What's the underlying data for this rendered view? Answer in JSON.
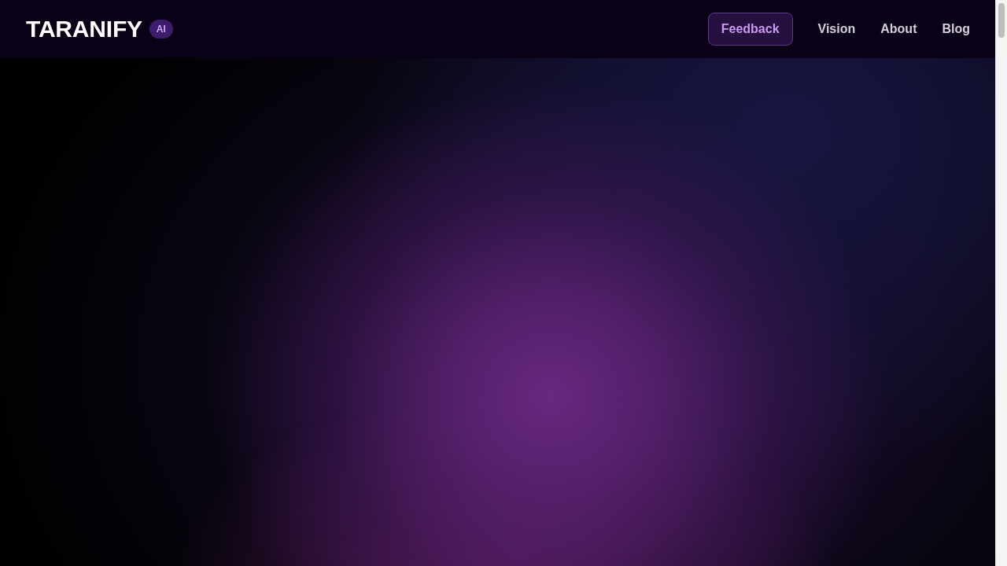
{
  "header": {
    "logo": "TARANIFY",
    "badge": "AI",
    "nav": [
      {
        "label": "Feedback",
        "kind": "button"
      },
      {
        "label": "Vision",
        "kind": "link"
      },
      {
        "label": "About",
        "kind": "link"
      },
      {
        "label": "Blog",
        "kind": "link"
      }
    ]
  }
}
